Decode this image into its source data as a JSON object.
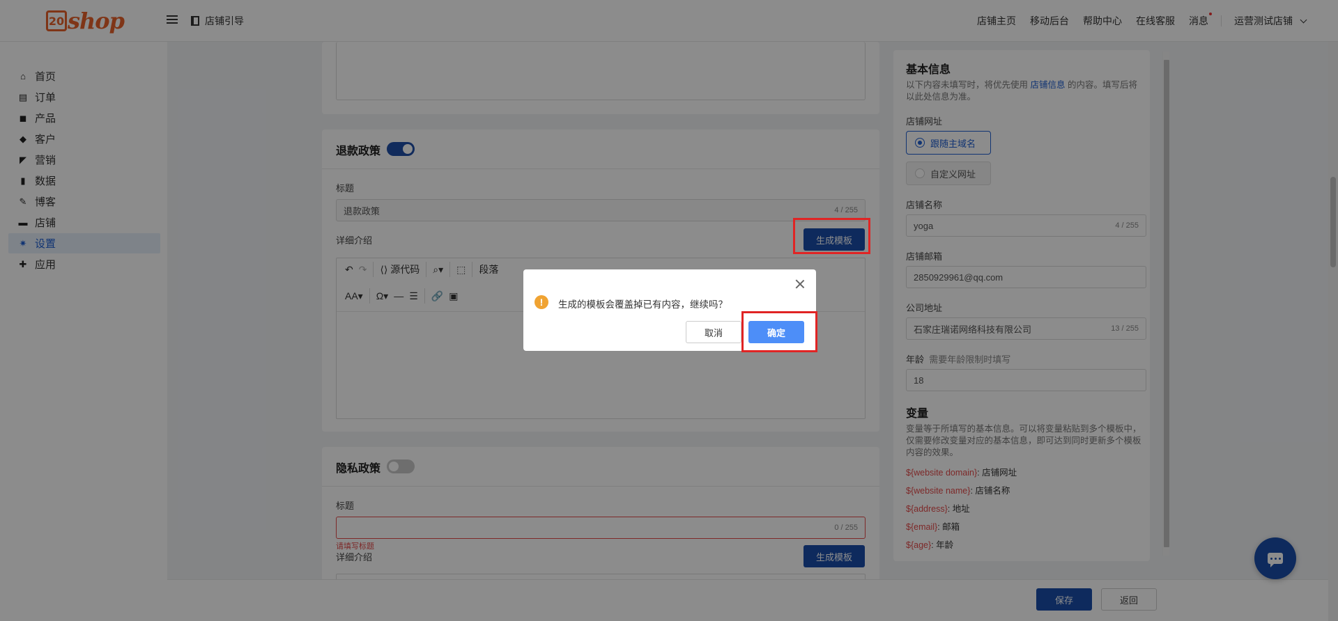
{
  "header": {
    "logo_mark": "20",
    "logo_text": "shop",
    "guide_label": "店铺引导",
    "nav": [
      "店铺主页",
      "移动后台",
      "帮助中心",
      "在线客服",
      "消息"
    ],
    "store_name": "运营测试店铺"
  },
  "sidebar": {
    "items": [
      {
        "label": "首页",
        "icon": "⌂"
      },
      {
        "label": "订单",
        "icon": "▤"
      },
      {
        "label": "产品",
        "icon": "◼"
      },
      {
        "label": "客户",
        "icon": "◆"
      },
      {
        "label": "营销",
        "icon": "◤"
      },
      {
        "label": "数据",
        "icon": "▮"
      },
      {
        "label": "博客",
        "icon": "✎"
      },
      {
        "label": "店铺",
        "icon": "▬"
      },
      {
        "label": "设置",
        "icon": "✷"
      },
      {
        "label": "应用",
        "icon": "✚"
      }
    ],
    "active": "设置"
  },
  "refund": {
    "title": "退款政策",
    "enabled": true,
    "title_label": "标题",
    "title_value": "退款政策",
    "title_count": "4 / 255",
    "detail_label": "详细介绍",
    "gen_button": "生成模板",
    "toolbar": {
      "source_code": "源代码",
      "paragraph": "段落"
    }
  },
  "privacy": {
    "title": "隐私政策",
    "enabled": false,
    "title_label": "标题",
    "title_value": "",
    "title_count": "0 / 255",
    "error": "请填写标题",
    "detail_label": "详细介绍",
    "gen_button": "生成模板"
  },
  "basic_info": {
    "title": "基本信息",
    "desc_prefix": "以下内容未填写时，将优先使用 ",
    "desc_link": "店铺信息",
    "desc_suffix": " 的内容。填写后将以此处信息为准。",
    "url_label": "店铺网址",
    "url_options": [
      "跟随主域名",
      "自定义网址"
    ],
    "name_label": "店铺名称",
    "name_value": "yoga",
    "name_count": "4 / 255",
    "email_label": "店铺邮箱",
    "email_value": "2850929961@qq.com",
    "address_label": "公司地址",
    "address_value": "石家庄瑞诺网络科技有限公司",
    "address_count": "13 / 255",
    "age_label": "年龄",
    "age_hint": "需要年龄限制时填写",
    "age_value": "18"
  },
  "variables": {
    "title": "变量",
    "desc": "变量等于所填写的基本信息。可以将变量粘贴到多个模板中，仅需要修改变量对应的基本信息，即可达到同时更新多个模板内容的效果。",
    "items": [
      {
        "var": "${website domain}",
        "desc": ": 店铺网址"
      },
      {
        "var": "${website name}",
        "desc": ": 店铺名称"
      },
      {
        "var": "${address}",
        "desc": ": 地址"
      },
      {
        "var": "${email}",
        "desc": ": 邮箱"
      },
      {
        "var": "${age}",
        "desc": ": 年龄"
      }
    ]
  },
  "footer": {
    "save": "保存",
    "back": "返回"
  },
  "dialog": {
    "message": "生成的模板会覆盖掉已有内容，继续吗？",
    "cancel": "取消",
    "confirm": "确定"
  },
  "colors": {
    "primary": "#1a4ea9",
    "dialog_confirm": "#4d8ef8",
    "highlight": "#e02424",
    "error": "#e34b4b",
    "warning": "#f0a332",
    "logo": "#e8622a"
  }
}
